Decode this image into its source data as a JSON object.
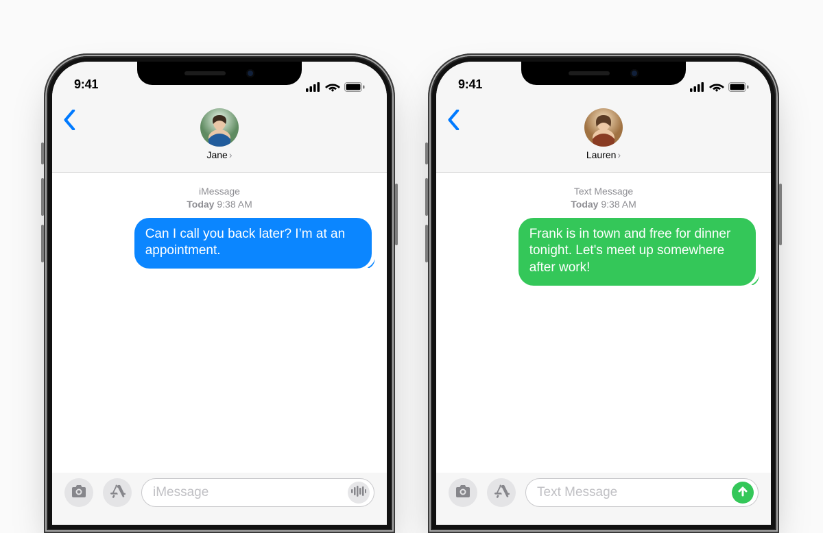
{
  "status": {
    "time": "9:41"
  },
  "phones": {
    "left": {
      "contact": "Jane",
      "stamp_service": "iMessage",
      "stamp_day": "Today",
      "stamp_time": "9:38 AM",
      "bubble_color": "blue",
      "message": "Can I call you back later? I’m at an appointment.",
      "compose_placeholder": "iMessage",
      "trailing_action": "audio"
    },
    "right": {
      "contact": "Lauren",
      "stamp_service": "Text Message",
      "stamp_day": "Today",
      "stamp_time": "9:38 AM",
      "bubble_color": "green",
      "message": "Frank is in town and free for dinner tonight. Let's meet up somewhere after work!",
      "compose_placeholder": "Text Message",
      "trailing_action": "send"
    }
  }
}
